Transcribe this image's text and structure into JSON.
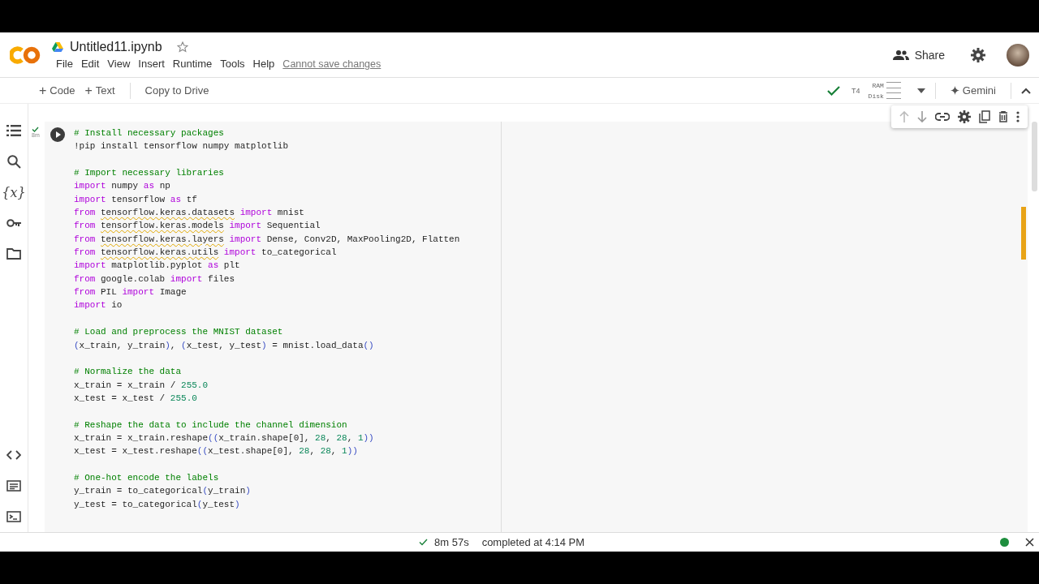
{
  "header": {
    "title": "Untitled11.ipynb",
    "menu": [
      "File",
      "Edit",
      "View",
      "Insert",
      "Runtime",
      "Tools",
      "Help"
    ],
    "save_notice": "Cannot save changes",
    "share": "Share"
  },
  "toolbar": {
    "buttons": [
      {
        "icon": "+",
        "label": "Code"
      },
      {
        "icon": "+",
        "label": "Text"
      }
    ],
    "copy": "Copy to Drive",
    "runtime": "T4",
    "ram": "RAM",
    "disk": "Disk",
    "gemini": "Gemini"
  },
  "sidebar": {
    "variables_icon": "{x}"
  },
  "cell": {
    "exec_time": "8m",
    "lines": [
      {
        "kind": "code",
        "tokens": [
          {
            "kind": "comment",
            "text": "# Install necessary packages"
          }
        ]
      },
      {
        "kind": "code",
        "tokens": [
          {
            "kind": "plain",
            "text": "!pip install tensorflow numpy matplotlib"
          }
        ]
      },
      {
        "kind": "blank"
      },
      {
        "kind": "code",
        "tokens": [
          {
            "kind": "comment",
            "text": "# Import necessary libraries"
          }
        ]
      },
      {
        "kind": "code",
        "tokens": [
          {
            "kind": "keyword",
            "text": "import"
          },
          {
            "kind": "plain",
            "text": " numpy "
          },
          {
            "kind": "keyword",
            "text": "as"
          },
          {
            "kind": "plain",
            "text": " np"
          }
        ]
      },
      {
        "kind": "code",
        "tokens": [
          {
            "kind": "keyword",
            "text": "import"
          },
          {
            "kind": "plain",
            "text": " tensorflow "
          },
          {
            "kind": "keyword",
            "text": "as"
          },
          {
            "kind": "plain",
            "text": " tf"
          }
        ]
      },
      {
        "kind": "code",
        "tokens": [
          {
            "kind": "keyword",
            "text": "from "
          },
          {
            "kind": "warn",
            "text": "tensorflow.keras.datasets"
          },
          {
            "kind": "keyword",
            "text": " import"
          },
          {
            "kind": "plain",
            "text": " mnist"
          }
        ]
      },
      {
        "kind": "code",
        "tokens": [
          {
            "kind": "keyword",
            "text": "from "
          },
          {
            "kind": "warn",
            "text": "tensorflow.keras.models"
          },
          {
            "kind": "keyword",
            "text": " import"
          },
          {
            "kind": "plain",
            "text": " Sequential"
          }
        ]
      },
      {
        "kind": "code",
        "tokens": [
          {
            "kind": "keyword",
            "text": "from "
          },
          {
            "kind": "warn",
            "text": "tensorflow.keras.layers"
          },
          {
            "kind": "keyword",
            "text": " import"
          },
          {
            "kind": "plain",
            "text": " Dense, Conv2D, MaxPooling2D, Flatten"
          }
        ]
      },
      {
        "kind": "code",
        "tokens": [
          {
            "kind": "keyword",
            "text": "from "
          },
          {
            "kind": "warn",
            "text": "tensorflow.keras.utils"
          },
          {
            "kind": "keyword",
            "text": " import"
          },
          {
            "kind": "plain",
            "text": " to_categorical"
          }
        ]
      },
      {
        "kind": "code",
        "tokens": [
          {
            "kind": "keyword",
            "text": "import"
          },
          {
            "kind": "plain",
            "text": " matplotlib.pyplot "
          },
          {
            "kind": "keyword",
            "text": "as"
          },
          {
            "kind": "plain",
            "text": " plt"
          }
        ]
      },
      {
        "kind": "code",
        "tokens": [
          {
            "kind": "keyword",
            "text": "from"
          },
          {
            "kind": "plain",
            "text": " google.colab "
          },
          {
            "kind": "keyword",
            "text": "import"
          },
          {
            "kind": "plain",
            "text": " files"
          }
        ]
      },
      {
        "kind": "code",
        "tokens": [
          {
            "kind": "keyword",
            "text": "from"
          },
          {
            "kind": "plain",
            "text": " PIL "
          },
          {
            "kind": "keyword",
            "text": "import"
          },
          {
            "kind": "plain",
            "text": " Image"
          }
        ]
      },
      {
        "kind": "code",
        "tokens": [
          {
            "kind": "keyword",
            "text": "import"
          },
          {
            "kind": "plain",
            "text": " io"
          }
        ]
      },
      {
        "kind": "blank"
      },
      {
        "kind": "code",
        "tokens": [
          {
            "kind": "comment",
            "text": "# Load and preprocess the MNIST dataset"
          }
        ]
      },
      {
        "kind": "code",
        "tokens": [
          {
            "kind": "paren",
            "text": "("
          },
          {
            "kind": "plain",
            "text": "x_train, y_train"
          },
          {
            "kind": "paren",
            "text": ")"
          },
          {
            "kind": "plain",
            "text": ", "
          },
          {
            "kind": "paren",
            "text": "("
          },
          {
            "kind": "plain",
            "text": "x_test, y_test"
          },
          {
            "kind": "paren",
            "text": ")"
          },
          {
            "kind": "plain",
            "text": " = mnist.load_data"
          },
          {
            "kind": "paren",
            "text": "()"
          }
        ]
      },
      {
        "kind": "blank"
      },
      {
        "kind": "code",
        "tokens": [
          {
            "kind": "comment",
            "text": "# Normalize the data"
          }
        ]
      },
      {
        "kind": "code",
        "tokens": [
          {
            "kind": "plain",
            "text": "x_train = x_train / "
          },
          {
            "kind": "number",
            "text": "255.0"
          }
        ]
      },
      {
        "kind": "code",
        "tokens": [
          {
            "kind": "plain",
            "text": "x_test = x_test / "
          },
          {
            "kind": "number",
            "text": "255.0"
          }
        ]
      },
      {
        "kind": "blank"
      },
      {
        "kind": "code",
        "tokens": [
          {
            "kind": "comment",
            "text": "# Reshape the data to include the channel dimension"
          }
        ]
      },
      {
        "kind": "code",
        "tokens": [
          {
            "kind": "plain",
            "text": "x_train = x_train.reshape"
          },
          {
            "kind": "paren",
            "text": "(("
          },
          {
            "kind": "plain",
            "text": "x_train.shape[0], "
          },
          {
            "kind": "number",
            "text": "28"
          },
          {
            "kind": "plain",
            "text": ", "
          },
          {
            "kind": "number",
            "text": "28"
          },
          {
            "kind": "plain",
            "text": ", "
          },
          {
            "kind": "number",
            "text": "1"
          },
          {
            "kind": "paren",
            "text": "))"
          }
        ]
      },
      {
        "kind": "code",
        "tokens": [
          {
            "kind": "plain",
            "text": "x_test = x_test.reshape"
          },
          {
            "kind": "paren",
            "text": "(("
          },
          {
            "kind": "plain",
            "text": "x_test.shape[0], "
          },
          {
            "kind": "number",
            "text": "28"
          },
          {
            "kind": "plain",
            "text": ", "
          },
          {
            "kind": "number",
            "text": "28"
          },
          {
            "kind": "plain",
            "text": ", "
          },
          {
            "kind": "number",
            "text": "1"
          },
          {
            "kind": "paren",
            "text": "))"
          }
        ]
      },
      {
        "kind": "blank"
      },
      {
        "kind": "code",
        "tokens": [
          {
            "kind": "comment",
            "text": "# One-hot encode the labels"
          }
        ]
      },
      {
        "kind": "code",
        "tokens": [
          {
            "kind": "plain",
            "text": "y_train = to_categorical"
          },
          {
            "kind": "paren",
            "text": "("
          },
          {
            "kind": "plain",
            "text": "y_train"
          },
          {
            "kind": "paren",
            "text": ")"
          }
        ]
      },
      {
        "kind": "code",
        "tokens": [
          {
            "kind": "plain",
            "text": "y_test = to_categorical"
          },
          {
            "kind": "paren",
            "text": "("
          },
          {
            "kind": "plain",
            "text": "y_test"
          },
          {
            "kind": "paren",
            "text": ")"
          }
        ]
      }
    ]
  },
  "status_bar": {
    "duration": "8m 57s",
    "message": "completed at 4:14 PM"
  }
}
